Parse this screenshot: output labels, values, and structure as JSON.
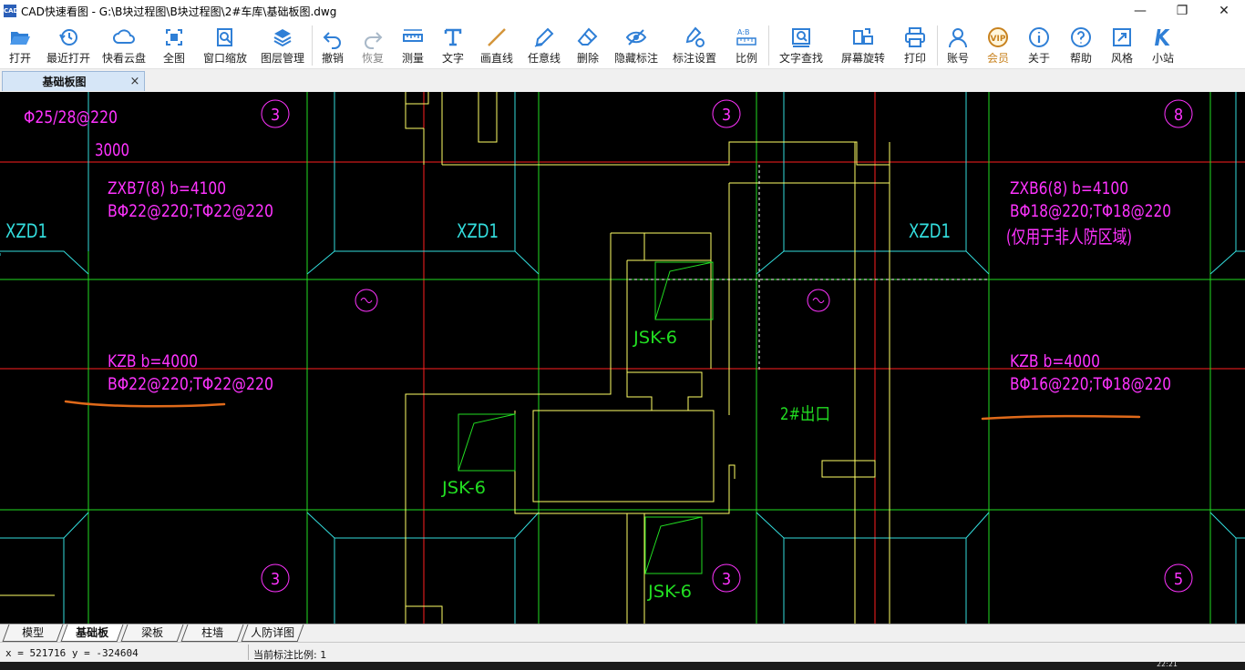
{
  "window": {
    "icon_text": "CAD",
    "title": "CAD快速看图 - G:\\B块过程图\\B块过程图\\2#车库\\基础板图.dwg",
    "minimize": "—",
    "maximize": "❐",
    "close": "✕"
  },
  "toolbar": {
    "open": "打开",
    "recent": "最近打开",
    "cloud": "快看云盘",
    "fit": "全图",
    "zoom_window": "窗口缩放",
    "layers": "图层管理",
    "undo": "撤销",
    "redo": "恢复",
    "measure": "测量",
    "text": "文字",
    "line": "画直线",
    "freehand": "任意线",
    "erase": "删除",
    "hide_marks": "隐藏标注",
    "mark_settings": "标注设置",
    "scale": "比例",
    "find_text": "文字查找",
    "rotate": "屏幕旋转",
    "print": "打印",
    "account": "账号",
    "vip": "会员",
    "about": "关于",
    "help": "帮助",
    "style": "风格",
    "site": "小站"
  },
  "document_tab": {
    "label": "基础板图",
    "close": "×"
  },
  "drawing": {
    "rebar_top": "Φ25/28@220",
    "dim_3000": "3000",
    "zxb7_line1": "ZXB7(8) b=4100",
    "zxb7_line2": "BΦ22@220;TΦ22@220",
    "zxb6_line1": "ZXB6(8) b=4100",
    "zxb6_line2": "BΦ18@220;TΦ18@220",
    "zxb6_line3": "(仅用于非人防区域)",
    "xzd1": "XZD1",
    "kzb_left_line1": "KZB b=4000",
    "kzb_left_line2": "BΦ22@220;TΦ22@220",
    "kzb_right_line1": "KZB b=4000",
    "kzb_right_line2": "BΦ16@220;TΦ18@220",
    "jsk6": "JSK-6",
    "exit_label": "2#出口",
    "bubble_3": "3",
    "bubble_8": "8",
    "bubble_5": "5"
  },
  "layout_tabs": [
    "模型",
    "基础板",
    "梁板",
    "柱墙",
    "人防详图"
  ],
  "active_layout": "基础板",
  "status": {
    "coords": "x = 521716 y = -324604",
    "scale_text": "当前标注比例: 1"
  },
  "taskbar": {
    "clock": "22:21"
  },
  "colors": {
    "cad_background": "#000000",
    "axis_red": "#ff2020",
    "axis_green": "#22dd22",
    "wall_cyan": "#33dddd",
    "outline_yellow": "#ffff66",
    "text_magenta": "#ff33ff",
    "annot_orange": "#e06a1a",
    "icon_blue": "#2f7fd6"
  }
}
